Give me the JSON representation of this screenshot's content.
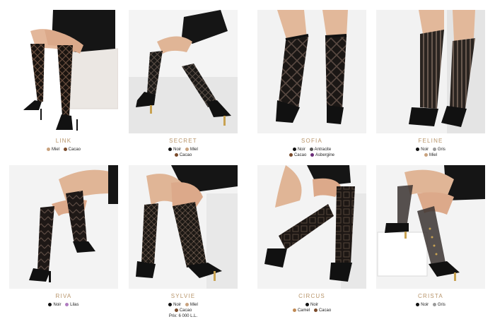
{
  "products": [
    {
      "name": "LINK",
      "colors": [
        [
          {
            "label": "Miel",
            "hex": "#c9a27e"
          },
          {
            "label": "Cacao",
            "hex": "#7a4a2a"
          }
        ]
      ]
    },
    {
      "name": "SECRET",
      "colors": [
        [
          {
            "label": "Noir",
            "hex": "#111111"
          },
          {
            "label": "Miel",
            "hex": "#c9a27e"
          }
        ],
        [
          {
            "label": "Cacao",
            "hex": "#7a4a2a"
          }
        ]
      ]
    },
    {
      "name": "SOFIA",
      "colors": [
        [
          {
            "label": "Noir",
            "hex": "#111111"
          },
          {
            "label": "Antracite",
            "hex": "#555555"
          }
        ],
        [
          {
            "label": "Cacao",
            "hex": "#7a4a2a"
          },
          {
            "label": "Asbergine",
            "hex": "#6b2d7a"
          }
        ]
      ]
    },
    {
      "name": "FELINE",
      "colors": [
        [
          {
            "label": "Noir",
            "hex": "#111111"
          },
          {
            "label": "Gris",
            "hex": "#9a9a9a"
          }
        ],
        [
          {
            "label": "Miel",
            "hex": "#c9a27e"
          }
        ]
      ]
    },
    {
      "name": "RIVA",
      "colors": [
        [
          {
            "label": "Noir",
            "hex": "#111111"
          },
          {
            "label": "Lilas",
            "hex": "#b07cc0"
          }
        ]
      ]
    },
    {
      "name": "SYLVIE",
      "colors": [
        [
          {
            "label": "Noir",
            "hex": "#111111"
          },
          {
            "label": "Miel",
            "hex": "#c9a27e"
          }
        ],
        [
          {
            "label": "Cacao",
            "hex": "#7a4a2a"
          }
        ]
      ],
      "price": "Prix: 6 000 L.L."
    },
    {
      "name": "CIRCUS",
      "colors": [
        [
          {
            "label": "Noir",
            "hex": "#111111"
          }
        ],
        [
          {
            "label": "Camel",
            "hex": "#c08a55"
          },
          {
            "label": "Cacao",
            "hex": "#7a4a2a"
          }
        ]
      ]
    },
    {
      "name": "CRISTA",
      "colors": [
        [
          {
            "label": "Noir",
            "hex": "#111111"
          },
          {
            "label": "Gris",
            "hex": "#9a9a9a"
          }
        ]
      ]
    }
  ]
}
